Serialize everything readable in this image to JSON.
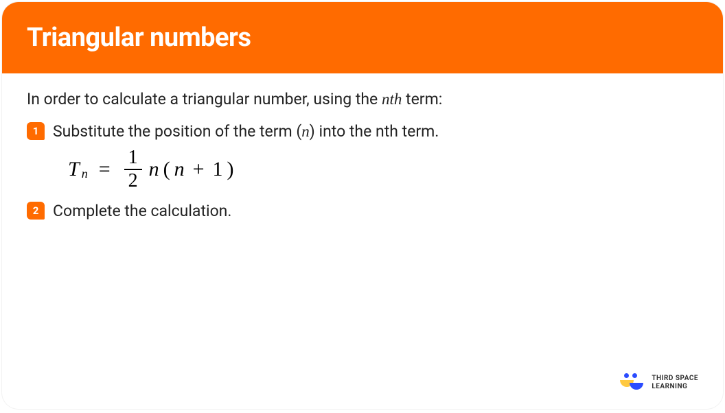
{
  "header": {
    "title": "Triangular numbers"
  },
  "intro": {
    "text_before": "In order to calculate a triangular number, using the ",
    "nth": "nth",
    "text_after": " term:"
  },
  "steps": [
    {
      "num": "1",
      "text_before": "Substitute the position of the term (",
      "var": "n",
      "text_after": ") into the nth term."
    },
    {
      "num": "2",
      "text_before": "Complete the calculation.",
      "var": "",
      "text_after": ""
    }
  ],
  "formula": {
    "T": "T",
    "sub": "n",
    "eq": "=",
    "frac_num": "1",
    "frac_den": "2",
    "n1": "n",
    "open": "(",
    "n2": "n",
    "plus": "+",
    "one": "1",
    "close": ")"
  },
  "brand": {
    "line1": "THIRD SPACE",
    "line2": "LEARNING"
  }
}
